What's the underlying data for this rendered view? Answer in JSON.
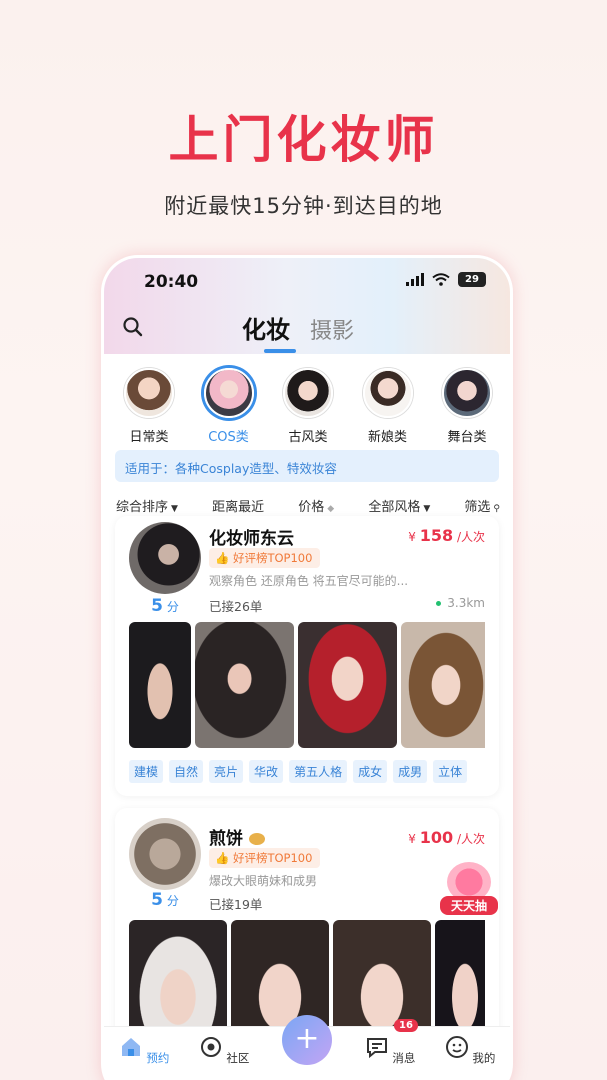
{
  "promo": {
    "title": "上门化妆师",
    "subtitle": "附近最快15分钟·到达目的地"
  },
  "status_bar": {
    "time": "20:40",
    "battery": "29"
  },
  "header": {
    "search_icon": "search-icon",
    "tabs": [
      {
        "label": "化妆",
        "active": true
      },
      {
        "label": "摄影",
        "active": false
      }
    ]
  },
  "categories": [
    {
      "label": "日常类",
      "selected": false
    },
    {
      "label": "COS类",
      "selected": true
    },
    {
      "label": "古风类",
      "selected": false
    },
    {
      "label": "新娘类",
      "selected": false
    },
    {
      "label": "舞台类",
      "selected": false
    }
  ],
  "apply_bar": {
    "text": "适用于：各种Cosplay造型、特效妆容"
  },
  "filters": [
    {
      "label": "综合排序",
      "arrow": "▼"
    },
    {
      "label": "距离最近",
      "arrow": ""
    },
    {
      "label": "价格",
      "arrow": "◆"
    },
    {
      "label": "全部风格",
      "arrow": "▼"
    },
    {
      "label": "筛选",
      "arrow": "⚲"
    }
  ],
  "artists": [
    {
      "name": "化妆师东云",
      "price_symbol": "¥",
      "price": "158",
      "price_unit": "/人次",
      "badge": "好评榜TOP100",
      "desc": "观察角色 还原角色 将五官尽可能的...",
      "orders": "已接26单",
      "distance": "3.3km",
      "score": "5",
      "score_unit": "分",
      "tags": [
        "建模",
        "自然",
        "亮片",
        "华改",
        "第五人格",
        "成女",
        "成男",
        "立体"
      ]
    },
    {
      "name": "煎饼",
      "name_icon": "pancake-icon",
      "price_symbol": "¥",
      "price": "100",
      "price_unit": "/人次",
      "badge": "好评榜TOP100",
      "desc": "爆改大眼萌妹和成男",
      "orders": "已接19单",
      "score": "5",
      "score_unit": "分"
    }
  ],
  "float_promo": {
    "label": "天天抽"
  },
  "tabbar": {
    "items": [
      {
        "label": "预约",
        "icon": "home-icon",
        "active": true
      },
      {
        "label": "社区",
        "icon": "community-icon",
        "active": false
      },
      {
        "label": "",
        "icon": "plus-icon",
        "active": false
      },
      {
        "label": "消息",
        "icon": "message-icon",
        "active": false
      },
      {
        "label": "我的",
        "icon": "profile-icon",
        "active": false
      }
    ],
    "message_count": "16"
  },
  "colors": {
    "brand_red": "#e8334a",
    "accent_blue": "#3a8fe8",
    "badge_orange": "#f07a3a"
  }
}
